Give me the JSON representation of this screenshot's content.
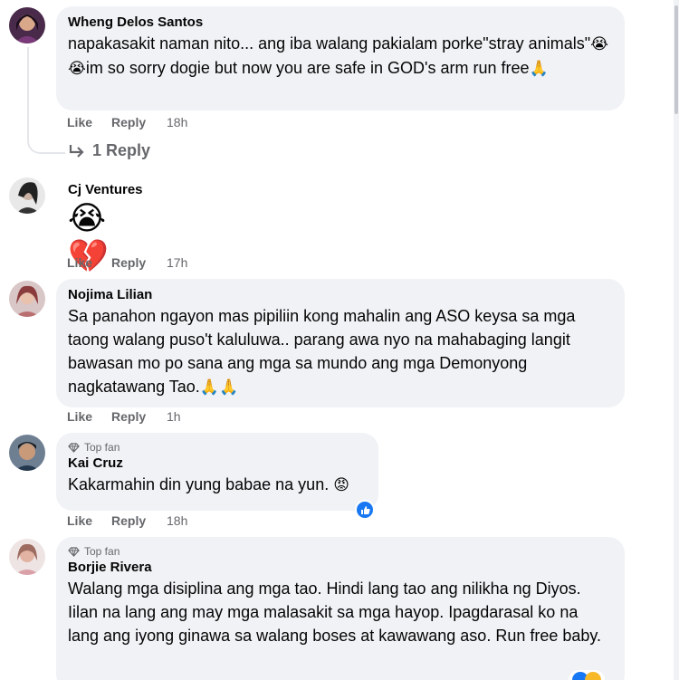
{
  "comments": [
    {
      "author": "Wheng Delos Santos",
      "text_before": "napakasakit naman nito... ang iba walang pakialam porke\"stray animals\"",
      "emojis_mid": "😭😭",
      "text_after": "im so sorry dogie but now you are safe in GOD's arm run free",
      "emoji_end": "🙏",
      "like": "Like",
      "reply": "Reply",
      "time": "18h",
      "replies_label": "1 Reply"
    },
    {
      "author": "Cj Ventures",
      "emojis": "😭💔",
      "like": "Like",
      "reply": "Reply",
      "time": "17h"
    },
    {
      "author": "Nojima Lilian",
      "text": "Sa panahon ngayon mas pipiliin kong mahalin ang ASO keysa sa mga taong walang puso't kaluluwa.. parang awa nyo na mahabaging langit bawasan mo po sana ang mga sa mundo ang mga Demonyong nagkatawang Tao.",
      "emoji_end": "🙏🙏",
      "like": "Like",
      "reply": "Reply",
      "time": "1h"
    },
    {
      "badge": "Top fan",
      "author": "Kai Cruz",
      "text": "Kakarmahin din yung babae na yun.",
      "emoji_end": "😡",
      "like": "Like",
      "reply": "Reply",
      "time": "18h"
    },
    {
      "badge": "Top fan",
      "author": "Borjie Rivera",
      "text": "Walang mga disiplina ang mga tao. Hindi lang tao ang nilikha ng Diyos. Iilan na lang ang may mga malasakit sa mga hayop. Ipagdarasal ko na lang ang iyong ginawa sa walang boses at kawawang aso. Run free baby."
    }
  ],
  "colors": {
    "bubble": "#f0f2f5",
    "meta_text": "#65676b",
    "like_blue": "#1877f2"
  },
  "icons": [
    "reply-arrow-icon",
    "diamond-icon",
    "like-reaction-icon"
  ]
}
